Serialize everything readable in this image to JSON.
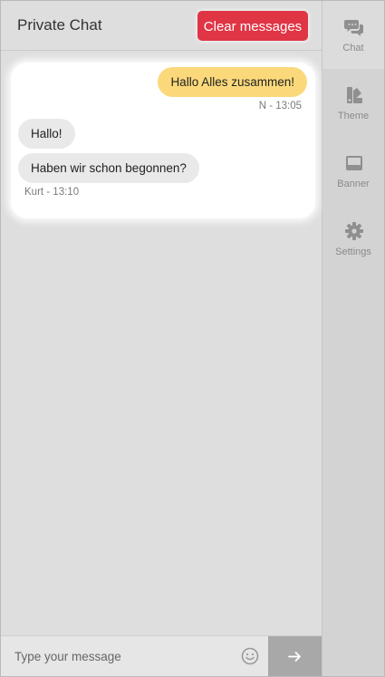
{
  "header": {
    "title": "Private Chat",
    "clear_label": "Clear messages"
  },
  "messages": [
    {
      "direction": "outgoing",
      "text": "Hallo Alles zusammen!",
      "meta": "N - 13:05"
    },
    {
      "direction": "incoming",
      "text": "Hallo!"
    },
    {
      "direction": "incoming",
      "text": "Haben wir schon begonnen?",
      "meta": "Kurt - 13:10"
    }
  ],
  "composer": {
    "placeholder": "Type your message",
    "value": "",
    "emoji_icon": "smiley-icon",
    "send_icon": "arrow-right-icon"
  },
  "sidebar": {
    "items": [
      {
        "label": "Chat",
        "icon": "chat-bubbles-icon",
        "active": true
      },
      {
        "label": "Theme",
        "icon": "theme-palette-icon",
        "active": false
      },
      {
        "label": "Banner",
        "icon": "banner-icon",
        "active": false
      },
      {
        "label": "Settings",
        "icon": "gear-icon",
        "active": false
      }
    ]
  },
  "colors": {
    "accent_red": "#e03545",
    "outgoing_bubble": "#fbd97b",
    "incoming_bubble": "#e9e9e9",
    "icon_gray": "#8f8f8f"
  }
}
